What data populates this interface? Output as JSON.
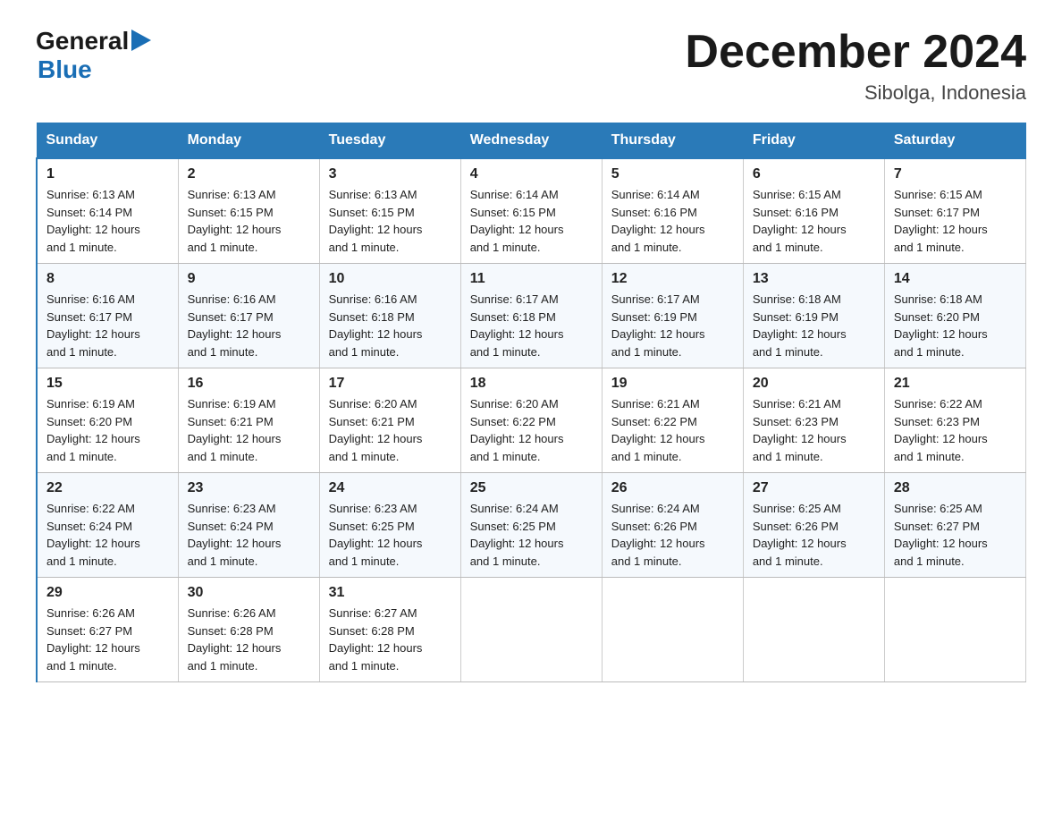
{
  "logo": {
    "text_general": "General",
    "text_blue": "Blue"
  },
  "header": {
    "month": "December 2024",
    "location": "Sibolga, Indonesia"
  },
  "days_of_week": [
    "Sunday",
    "Monday",
    "Tuesday",
    "Wednesday",
    "Thursday",
    "Friday",
    "Saturday"
  ],
  "weeks": [
    [
      {
        "day": "1",
        "sunrise": "6:13 AM",
        "sunset": "6:14 PM",
        "daylight": "12 hours and 1 minute."
      },
      {
        "day": "2",
        "sunrise": "6:13 AM",
        "sunset": "6:15 PM",
        "daylight": "12 hours and 1 minute."
      },
      {
        "day": "3",
        "sunrise": "6:13 AM",
        "sunset": "6:15 PM",
        "daylight": "12 hours and 1 minute."
      },
      {
        "day": "4",
        "sunrise": "6:14 AM",
        "sunset": "6:15 PM",
        "daylight": "12 hours and 1 minute."
      },
      {
        "day": "5",
        "sunrise": "6:14 AM",
        "sunset": "6:16 PM",
        "daylight": "12 hours and 1 minute."
      },
      {
        "day": "6",
        "sunrise": "6:15 AM",
        "sunset": "6:16 PM",
        "daylight": "12 hours and 1 minute."
      },
      {
        "day": "7",
        "sunrise": "6:15 AM",
        "sunset": "6:17 PM",
        "daylight": "12 hours and 1 minute."
      }
    ],
    [
      {
        "day": "8",
        "sunrise": "6:16 AM",
        "sunset": "6:17 PM",
        "daylight": "12 hours and 1 minute."
      },
      {
        "day": "9",
        "sunrise": "6:16 AM",
        "sunset": "6:17 PM",
        "daylight": "12 hours and 1 minute."
      },
      {
        "day": "10",
        "sunrise": "6:16 AM",
        "sunset": "6:18 PM",
        "daylight": "12 hours and 1 minute."
      },
      {
        "day": "11",
        "sunrise": "6:17 AM",
        "sunset": "6:18 PM",
        "daylight": "12 hours and 1 minute."
      },
      {
        "day": "12",
        "sunrise": "6:17 AM",
        "sunset": "6:19 PM",
        "daylight": "12 hours and 1 minute."
      },
      {
        "day": "13",
        "sunrise": "6:18 AM",
        "sunset": "6:19 PM",
        "daylight": "12 hours and 1 minute."
      },
      {
        "day": "14",
        "sunrise": "6:18 AM",
        "sunset": "6:20 PM",
        "daylight": "12 hours and 1 minute."
      }
    ],
    [
      {
        "day": "15",
        "sunrise": "6:19 AM",
        "sunset": "6:20 PM",
        "daylight": "12 hours and 1 minute."
      },
      {
        "day": "16",
        "sunrise": "6:19 AM",
        "sunset": "6:21 PM",
        "daylight": "12 hours and 1 minute."
      },
      {
        "day": "17",
        "sunrise": "6:20 AM",
        "sunset": "6:21 PM",
        "daylight": "12 hours and 1 minute."
      },
      {
        "day": "18",
        "sunrise": "6:20 AM",
        "sunset": "6:22 PM",
        "daylight": "12 hours and 1 minute."
      },
      {
        "day": "19",
        "sunrise": "6:21 AM",
        "sunset": "6:22 PM",
        "daylight": "12 hours and 1 minute."
      },
      {
        "day": "20",
        "sunrise": "6:21 AM",
        "sunset": "6:23 PM",
        "daylight": "12 hours and 1 minute."
      },
      {
        "day": "21",
        "sunrise": "6:22 AM",
        "sunset": "6:23 PM",
        "daylight": "12 hours and 1 minute."
      }
    ],
    [
      {
        "day": "22",
        "sunrise": "6:22 AM",
        "sunset": "6:24 PM",
        "daylight": "12 hours and 1 minute."
      },
      {
        "day": "23",
        "sunrise": "6:23 AM",
        "sunset": "6:24 PM",
        "daylight": "12 hours and 1 minute."
      },
      {
        "day": "24",
        "sunrise": "6:23 AM",
        "sunset": "6:25 PM",
        "daylight": "12 hours and 1 minute."
      },
      {
        "day": "25",
        "sunrise": "6:24 AM",
        "sunset": "6:25 PM",
        "daylight": "12 hours and 1 minute."
      },
      {
        "day": "26",
        "sunrise": "6:24 AM",
        "sunset": "6:26 PM",
        "daylight": "12 hours and 1 minute."
      },
      {
        "day": "27",
        "sunrise": "6:25 AM",
        "sunset": "6:26 PM",
        "daylight": "12 hours and 1 minute."
      },
      {
        "day": "28",
        "sunrise": "6:25 AM",
        "sunset": "6:27 PM",
        "daylight": "12 hours and 1 minute."
      }
    ],
    [
      {
        "day": "29",
        "sunrise": "6:26 AM",
        "sunset": "6:27 PM",
        "daylight": "12 hours and 1 minute."
      },
      {
        "day": "30",
        "sunrise": "6:26 AM",
        "sunset": "6:28 PM",
        "daylight": "12 hours and 1 minute."
      },
      {
        "day": "31",
        "sunrise": "6:27 AM",
        "sunset": "6:28 PM",
        "daylight": "12 hours and 1 minute."
      },
      null,
      null,
      null,
      null
    ]
  ],
  "labels": {
    "sunrise": "Sunrise:",
    "sunset": "Sunset:",
    "daylight": "Daylight:"
  }
}
